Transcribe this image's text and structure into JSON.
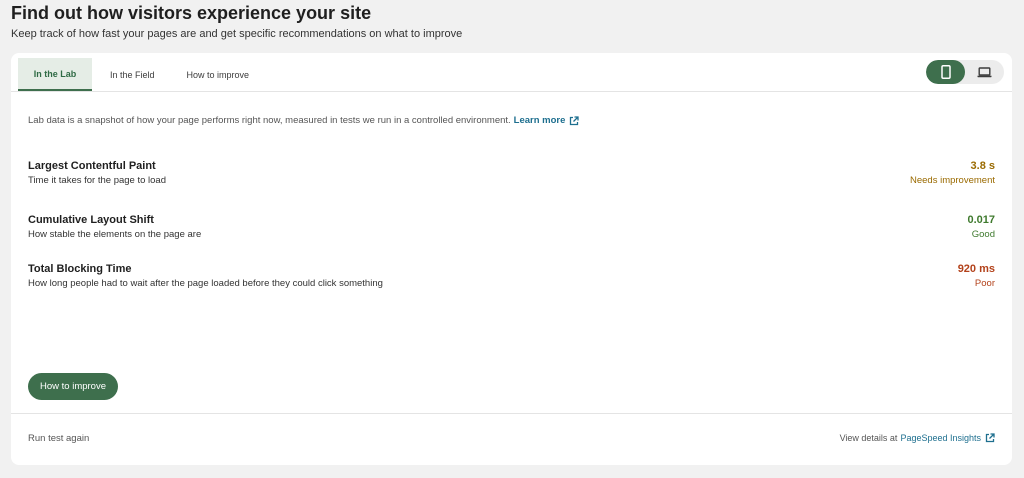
{
  "header": {
    "title": "Find out how visitors experience your site",
    "subtitle": "Keep track of how fast your pages are and get specific recommendations on what to improve"
  },
  "tabs": [
    {
      "label": "In the Lab",
      "active": true
    },
    {
      "label": "In the Field",
      "active": false
    },
    {
      "label": "How to improve",
      "active": false
    }
  ],
  "device_toggle": {
    "selected": "mobile",
    "icons": [
      "phone-icon",
      "laptop-icon"
    ]
  },
  "intro": {
    "text": "Lab data is a snapshot of how your page performs right now, measured in tests we run in a controlled environment.",
    "link": "Learn more"
  },
  "metrics": [
    {
      "name": "Largest Contentful Paint",
      "description": "Time it takes for the page to load",
      "value": "3.8 s",
      "status": "Needs improvement",
      "color": "#9a6a00"
    },
    {
      "name": "Cumulative Layout Shift",
      "description": "How stable the elements on the page are",
      "value": "0.017",
      "status": "Good",
      "color": "#3f7a2e"
    },
    {
      "name": "Total Blocking Time",
      "description": "How long people had to wait after the page loaded before they could click something",
      "value": "920 ms",
      "status": "Poor",
      "color": "#b3421b"
    }
  ],
  "improve_button": "How to improve",
  "footer": {
    "run_again": "Run test again",
    "details_prefix": "View details at",
    "details_link": "PageSpeed Insights"
  },
  "colors": {
    "accent": "#3e6f4d",
    "link": "#1e6f8f"
  }
}
